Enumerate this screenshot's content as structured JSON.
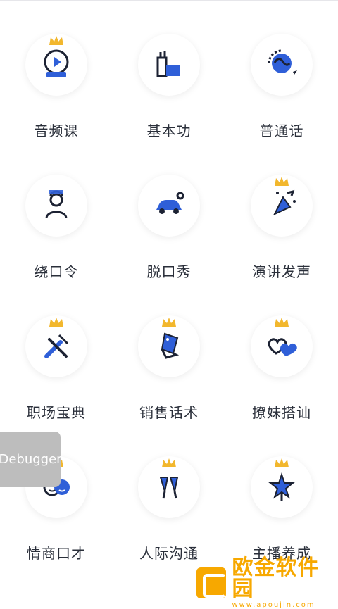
{
  "colors": {
    "accent_blue": "#2f5fd8",
    "ink": "#1c2233",
    "crown": "#f2b72d"
  },
  "courses": [
    {
      "label": "音频课",
      "icon": "audio-lesson-icon",
      "crown": true
    },
    {
      "label": "基本功",
      "icon": "factory-building-icon",
      "crown": false
    },
    {
      "label": "普通话",
      "icon": "globe-plane-icon",
      "crown": false
    },
    {
      "label": "绕口令",
      "icon": "chef-person-icon",
      "crown": false
    },
    {
      "label": "脱口秀",
      "icon": "car-person-icon",
      "crown": false
    },
    {
      "label": "演讲发声",
      "icon": "party-popper-icon",
      "crown": true
    },
    {
      "label": "职场宝典",
      "icon": "tools-cross-icon",
      "crown": true
    },
    {
      "label": "销售话术",
      "icon": "price-tag-icon",
      "crown": true
    },
    {
      "label": "撩妹搭讪",
      "icon": "two-hearts-icon",
      "crown": true
    },
    {
      "label": "情商口才",
      "icon": "two-faces-icon",
      "crown": true
    },
    {
      "label": "人际沟通",
      "icon": "toast-glasses-icon",
      "crown": true
    },
    {
      "label": "主播养成",
      "icon": "star-trophy-icon",
      "crown": true
    }
  ],
  "debugger": {
    "label": "Debugger"
  },
  "watermark": {
    "cn": "欧金软件园",
    "en": "www.apoujin.com"
  }
}
